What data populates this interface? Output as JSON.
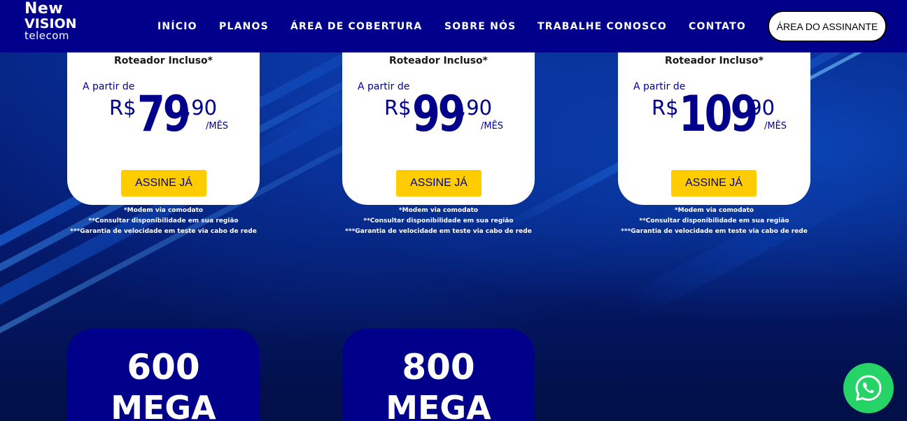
{
  "header": {
    "logo": {
      "line1": "New",
      "line2": "VISION",
      "line3": "telecom"
    },
    "nav": [
      {
        "label": "INÍCIO"
      },
      {
        "label": "PLANOS"
      },
      {
        "label": "ÁREA DE COBERTURA"
      },
      {
        "label": "SOBRE NÓS"
      },
      {
        "label": "TRABALHE CONOSCO"
      },
      {
        "label": "CONTATO"
      }
    ],
    "subscriber_button": "ÁREA DO ASSINANTE"
  },
  "plans": [
    {
      "router": "Roteador Incluso*",
      "from": "A partir de",
      "currency": "R$",
      "price_int": "79",
      "price_cents": ",90",
      "period": "/MÊS",
      "cta": "ASSINE JÁ"
    },
    {
      "router": "Roteador Incluso*",
      "from": "A partir de",
      "currency": "R$",
      "price_int": "99",
      "price_cents": ",90",
      "period": "/MÊS",
      "cta": "ASSINE JÁ"
    },
    {
      "router": "Roteador Incluso*",
      "from": "A partir de",
      "currency": "R$",
      "price_int": "109",
      "price_cents": ",90",
      "period": "/MÊS",
      "cta": "ASSINE JÁ"
    }
  ],
  "notes": [
    "*Modem via comodato",
    "**Consultar disponibilidade em sua região",
    "***Garantia de velocidade em teste via cabo de rede"
  ],
  "speed_cards": [
    {
      "value": "600",
      "unit": "MEGA"
    },
    {
      "value": "800",
      "unit": "MEGA"
    }
  ],
  "colors": {
    "brand_blue": "#00008b",
    "cta_yellow": "#ffcc00",
    "whatsapp_green": "#25d366"
  },
  "icons": {
    "whatsapp": "whatsapp-icon"
  }
}
